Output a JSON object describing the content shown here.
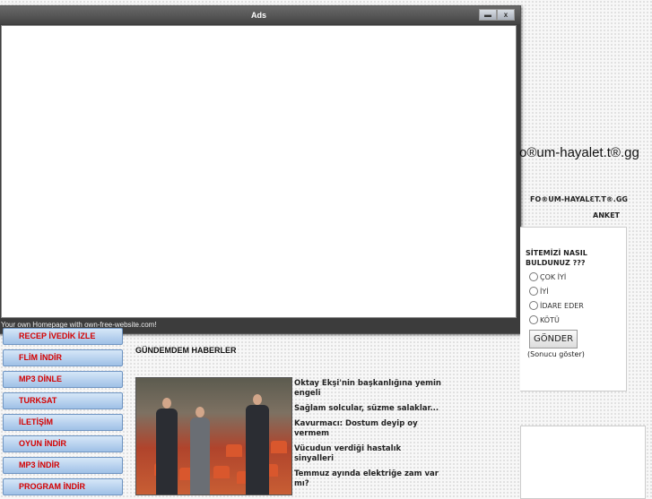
{
  "ads_window": {
    "title": "Ads",
    "minimize_label": "▬",
    "close_label": "x",
    "footer_text": "Your own Homepage with own-free-website.com!"
  },
  "site": {
    "title": "o®um-hayalet.t®.gg",
    "brand": "FO®UM-HAYALƐT.T®.GG"
  },
  "poll": {
    "label": "ANKET",
    "question": "SİTEMİZİ NASIL BULDUNUZ ???",
    "options": [
      "ÇOK İYİ",
      "İYİ",
      "İDARE EDER",
      "KÖTÜ"
    ],
    "submit_label": "GÖNDER",
    "results_link": "(Sonucu göster)"
  },
  "nav": {
    "items": [
      "RECEP İVEDİK İZLE",
      "FLİM İNDİR",
      "MP3 DİNLE",
      "TURKSAT",
      "İLETİŞİM",
      "OYUN İNDİR",
      "MP3 İNDİR",
      "PROGRAM İNDİR"
    ]
  },
  "news": {
    "heading": "GÜNDEMDEM HABERLER",
    "items": [
      "Oktay Ekşi'nin başkanlığına yemin engeli",
      "Sağlam solcular, süzme salaklar...",
      "Kavurmacı: Dostum deyip oy vermem",
      "Vücudun verdiği hastalık sinyalleri",
      "Temmuz ayında elektriğe zam var mı?"
    ]
  },
  "colors": {
    "nav_text": "#d40000",
    "nav_bg": "#b9d3f0",
    "ads_chrome": "#4a4a4a"
  }
}
